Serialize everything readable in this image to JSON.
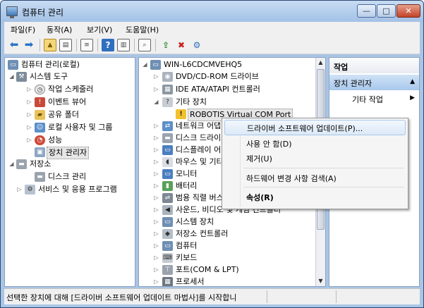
{
  "window": {
    "title": "컴퓨터 관리",
    "min_label": "—",
    "max_label": "□",
    "close_label": "✕"
  },
  "menu": [
    "파일(F)",
    "동작(A)",
    "보기(V)",
    "도움말(H)"
  ],
  "left_tree": [
    {
      "label": "컴퓨터 관리(로컬)",
      "icon": "computer-icon"
    },
    {
      "label": "시스템 도구",
      "icon": "tools-icon"
    },
    {
      "label": "작업 스케줄러",
      "icon": "clock-icon"
    },
    {
      "label": "이벤트 뷰어",
      "icon": "event-viewer-icon"
    },
    {
      "label": "공유 폴더",
      "icon": "shared-folder-icon"
    },
    {
      "label": "로컬 사용자 및 그룹",
      "icon": "users-icon"
    },
    {
      "label": "성능",
      "icon": "performance-icon"
    },
    {
      "label": "장치 관리자",
      "icon": "device-manager-icon"
    },
    {
      "label": "저장소",
      "icon": "storage-icon"
    },
    {
      "label": "디스크 관리",
      "icon": "disk-icon"
    },
    {
      "label": "서비스 및 응용 프로그램",
      "icon": "services-icon"
    }
  ],
  "device_tree": [
    {
      "label": "WIN-L6CDCMVEHQ5",
      "icon": "computer-icon"
    },
    {
      "label": "DVD/CD-ROM 드라이브",
      "icon": "dvd-icon"
    },
    {
      "label": "IDE ATA/ATAPI 컨트롤러",
      "icon": "ide-icon"
    },
    {
      "label": "기타 장치",
      "icon": "other-device-icon"
    },
    {
      "label": "ROBOTIS Virtual COM Port",
      "icon": "warning-device-icon"
    },
    {
      "label": "네트워크 어댑터",
      "icon": "network-icon"
    },
    {
      "label": "디스크 드라이브",
      "icon": "disk-drive-icon"
    },
    {
      "label": "디스플레이 어댑터",
      "icon": "display-icon"
    },
    {
      "label": "마우스 및 기타 포인팅 장치",
      "icon": "mouse-icon"
    },
    {
      "label": "모니터",
      "icon": "monitor-icon"
    },
    {
      "label": "배터리",
      "icon": "battery-icon"
    },
    {
      "label": "범용 직렬 버스 컨트롤러",
      "icon": "usb-icon"
    },
    {
      "label": "사운드, 비디오 및 게임 컨트롤러",
      "icon": "sound-icon"
    },
    {
      "label": "시스템 장치",
      "icon": "system-device-icon"
    },
    {
      "label": "저장소 컨트롤러",
      "icon": "storage-controller-icon"
    },
    {
      "label": "컴퓨터",
      "icon": "computer-node-icon"
    },
    {
      "label": "키보드",
      "icon": "keyboard-icon"
    },
    {
      "label": "포트(COM & LPT)",
      "icon": "port-icon"
    },
    {
      "label": "프로세서",
      "icon": "processor-icon"
    }
  ],
  "actions": {
    "header": "작업",
    "section": "장치 관리자",
    "item": "기타 작업"
  },
  "context_menu": [
    "드라이버 소프트웨어 업데이트(P)...",
    "사용 안 함(D)",
    "제거(U)",
    "하드웨어 변경 사항 검색(A)",
    "속성(R)"
  ],
  "status": "선택한 장치에 대해 [드라이버 소프트웨어 업데이트 마법사]를 시작합니"
}
